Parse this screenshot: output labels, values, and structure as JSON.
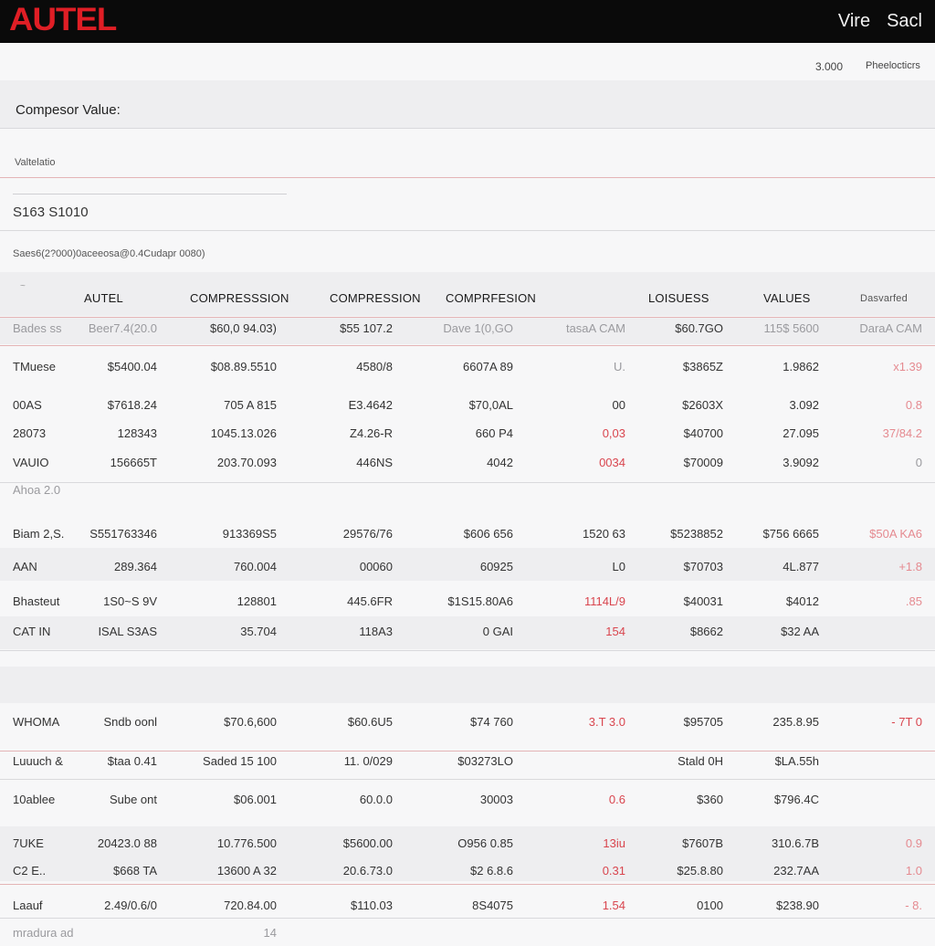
{
  "topbar": {
    "logo": "AUTEL",
    "nav": [
      "Vire",
      "Sacl"
    ]
  },
  "meta": {
    "left": "3.000",
    "right": "Pheelocticrs"
  },
  "section_title": "Compesor Value:",
  "sub_label": "Valtelatio",
  "value_box": "S163 S1010",
  "info_line": "Saes6(2?000)0aceeosa@0.4Cudapr 0080)",
  "table": {
    "corner_mark": "~",
    "headers": [
      "AUTEL",
      "COMPRESSSION",
      "COMPRESSION",
      "COMPRFESION",
      "",
      "LOISUESS",
      "VALUES",
      "Dasvarfed"
    ],
    "rows": [
      {
        "cells": [
          "Bades ss",
          "Beer7.4(20.0",
          "$60,0 94.03)",
          "$55 107.2",
          "Dave 1(0,GO",
          "tasaA CAM",
          "$60.7GO",
          "115$ 5600",
          "DaraA CAM"
        ],
        "styles": [
          "grey",
          "grey",
          "",
          "",
          "grey",
          "grey",
          "",
          "grey",
          "grey"
        ]
      },
      {
        "cells": [
          "TMuese",
          "$5400.04",
          "$08.89.5510",
          "4580/8",
          "6607A 89",
          "U.",
          "$3865Z",
          "1.9862",
          "x1.39"
        ],
        "styles": [
          "",
          "",
          "",
          "",
          "",
          "grey",
          "",
          "",
          "pink"
        ]
      },
      {
        "cells": [
          "00AS",
          "$7618.24",
          "705 A 815",
          "E3.4642",
          "$70,0AL",
          "00",
          "$2603X",
          "3.092",
          "0.8"
        ],
        "styles": [
          "",
          "",
          "",
          "",
          "",
          "",
          "",
          "",
          "pink"
        ]
      },
      {
        "cells": [
          "28073",
          "128343",
          "1045.13.026",
          "Z4.26-R",
          "660 P4",
          "0,03",
          "$40700",
          "27.095",
          "37/84.2"
        ],
        "styles": [
          "",
          "",
          "",
          "",
          "",
          "red",
          "",
          "",
          "pink"
        ]
      },
      {
        "cells": [
          "VAUIO",
          "156665T",
          "203.70.093",
          "446NS",
          "4042",
          "0034",
          "$70009",
          "3.9092",
          "0"
        ],
        "styles": [
          "",
          "",
          "",
          "",
          "",
          "red",
          "",
          "",
          "grey"
        ]
      },
      {
        "cells": [
          "Ahoa 2.0",
          "",
          "",
          "",
          "",
          "",
          "",
          "",
          ""
        ],
        "styles": [
          "grey",
          "",
          "",
          "",
          "",
          "",
          "",
          "",
          ""
        ]
      },
      {
        "cells": [
          "Biam 2,S.",
          "S551763346",
          "913369S5",
          "29576/76",
          "$606 656",
          "1520 63",
          "$5238852",
          "$756 6665",
          "$50A KA6"
        ],
        "styles": [
          "",
          "",
          "",
          "",
          "",
          "",
          "",
          "",
          "pink"
        ]
      },
      {
        "cells": [
          "AAN",
          "289.364",
          "760.004",
          "00060",
          "60925",
          "L0",
          "$70703",
          "4L.877",
          "+1.8"
        ],
        "styles": [
          "",
          "",
          "",
          "",
          "",
          "",
          "",
          "",
          "pink"
        ]
      },
      {
        "cells": [
          "Bhasteut",
          "1S0~S 9V",
          "128801",
          "445.6FR",
          "$1S15.80A6",
          "1114L/9",
          "$40031",
          "$4012",
          ".85"
        ],
        "styles": [
          "",
          "",
          "",
          "",
          "",
          "red",
          "",
          "",
          "pink"
        ]
      },
      {
        "cells": [
          "CAT IN",
          "ISAL  S3AS",
          "35.704",
          "118A3",
          "0 GAI",
          "154",
          "$8662",
          "$32 AA",
          ""
        ],
        "styles": [
          "",
          "",
          "",
          "",
          "",
          "red",
          "",
          "",
          ""
        ]
      }
    ],
    "rows2": [
      {
        "cells": [
          "WHOMA",
          "Sndb oonl",
          "$70.6,600",
          "$60.6U5",
          "$74 760",
          "3.T       3.0",
          "$95705",
          "235.8.95",
          "- 7T      0"
        ],
        "styles": [
          "",
          "",
          "",
          "",
          "",
          "red",
          "",
          "",
          "red"
        ]
      },
      {
        "cells": [
          "Luuuch &",
          "$taa 0.41",
          "Saded 15 100",
          "11. 0/029",
          "$03273LO",
          "",
          "Stald 0H",
          "$LA.55h",
          ""
        ],
        "styles": [
          "",
          "",
          "",
          "",
          "",
          "",
          "",
          "",
          ""
        ]
      },
      {
        "cells": [
          "10ablee",
          "Sube ont",
          "$06.001",
          "60.0.0",
          "30003",
          "0.6",
          "$360",
          "$796.4C",
          ""
        ],
        "styles": [
          "",
          "",
          "",
          "",
          "",
          "red",
          "",
          "",
          ""
        ]
      },
      {
        "cells": [
          "7UKE",
          "20423.0 88",
          "10.776.500",
          "$5600.00",
          "O956 0.85",
          "13iu",
          "$7607B",
          "310.6.7B",
          "0.9"
        ],
        "styles": [
          "",
          "",
          "",
          "",
          "",
          "red",
          "",
          "",
          "pink"
        ]
      },
      {
        "cells": [
          "C2 E..",
          "$668 TA",
          "13600 A 32",
          "20.6.73.0",
          "$2 6.8.6",
          "0.31",
          "$25.8.80",
          "232.7AA",
          "1.0"
        ],
        "styles": [
          "",
          "",
          "",
          "",
          "",
          "red",
          "",
          "",
          "pink"
        ]
      },
      {
        "cells": [
          "Laauf",
          "2.49/0.6/0",
          "720.84.00",
          "$110.03",
          "8S4075",
          "1.54",
          "0100",
          "$238.90",
          "- 8."
        ],
        "styles": [
          "",
          "",
          "",
          "",
          "",
          "red",
          "",
          "",
          "pink"
        ]
      },
      {
        "cells": [
          "mradura   ad",
          "",
          "14",
          "",
          "",
          "",
          "",
          "",
          ""
        ],
        "styles": [
          "grey",
          "",
          "grey",
          "",
          "",
          "",
          "",
          "",
          ""
        ]
      }
    ]
  }
}
